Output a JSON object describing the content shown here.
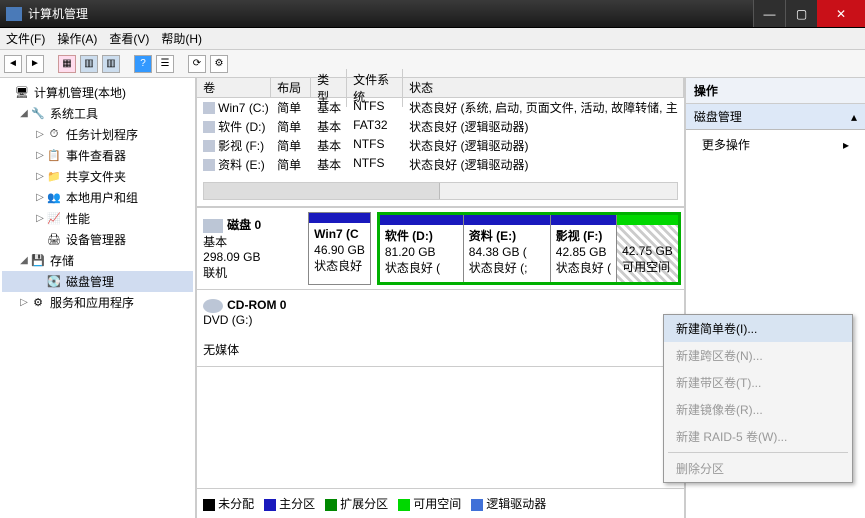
{
  "titlebar": {
    "title": "计算机管理"
  },
  "menubar": {
    "file": "文件(F)",
    "action": "操作(A)",
    "view": "查看(V)",
    "help": "帮助(H)"
  },
  "tree": {
    "root": "计算机管理(本地)",
    "system_tools": "系统工具",
    "task_scheduler": "任务计划程序",
    "event_viewer": "事件查看器",
    "shared_folders": "共享文件夹",
    "local_users": "本地用户和组",
    "performance": "性能",
    "device_manager": "设备管理器",
    "storage": "存储",
    "disk_management": "磁盘管理",
    "services_apps": "服务和应用程序"
  },
  "vol_headers": {
    "volume": "卷",
    "layout": "布局",
    "type": "类型",
    "filesystem": "文件系统",
    "status": "状态"
  },
  "volumes": [
    {
      "name": "Win7 (C:)",
      "layout": "简单",
      "type": "基本",
      "fs": "NTFS",
      "status": "状态良好 (系统, 启动, 页面文件, 活动, 故障转储, 主"
    },
    {
      "name": "软件 (D:)",
      "layout": "简单",
      "type": "基本",
      "fs": "FAT32",
      "status": "状态良好 (逻辑驱动器)"
    },
    {
      "name": "影视 (F:)",
      "layout": "简单",
      "type": "基本",
      "fs": "NTFS",
      "status": "状态良好 (逻辑驱动器)"
    },
    {
      "name": "资料 (E:)",
      "layout": "简单",
      "type": "基本",
      "fs": "NTFS",
      "status": "状态良好 (逻辑驱动器)"
    }
  ],
  "disk0": {
    "label": "磁盘 0",
    "type": "基本",
    "size": "298.09 GB",
    "status": "联机",
    "parts": [
      {
        "name": "Win7  (C",
        "size": "46.90 GB",
        "status": "状态良好",
        "bar": "navy",
        "kind": "primary"
      },
      {
        "name": "软件  (D:)",
        "size": "81.20 GB",
        "status": "状态良好 (",
        "bar": "navy",
        "kind": "logical"
      },
      {
        "name": "资料  (E:)",
        "size": "84.38 GB (",
        "status": "状态良好 (;",
        "bar": "navy",
        "kind": "logical"
      },
      {
        "name": "影视  (F:)",
        "size": "42.85 GB",
        "status": "状态良好 (",
        "bar": "navy",
        "kind": "logical"
      },
      {
        "name": "",
        "size": "42.75 GB",
        "status": "可用空间",
        "bar": "green",
        "kind": "free"
      }
    ]
  },
  "cdrom": {
    "label": "CD-ROM 0",
    "drive": "DVD (G:)",
    "status": "无媒体"
  },
  "legend": {
    "unalloc": "未分配",
    "primary": "主分区",
    "extended": "扩展分区",
    "free": "可用空间",
    "logical": "逻辑驱动器"
  },
  "actions": {
    "header": "操作",
    "disk_mgmt": "磁盘管理",
    "more": "更多操作"
  },
  "context_menu": {
    "new_simple": "新建简单卷(I)...",
    "new_spanned": "新建跨区卷(N)...",
    "new_striped": "新建带区卷(T)...",
    "new_mirror": "新建镜像卷(R)...",
    "new_raid5": "新建 RAID-5 卷(W)...",
    "delete": "删除分区"
  }
}
